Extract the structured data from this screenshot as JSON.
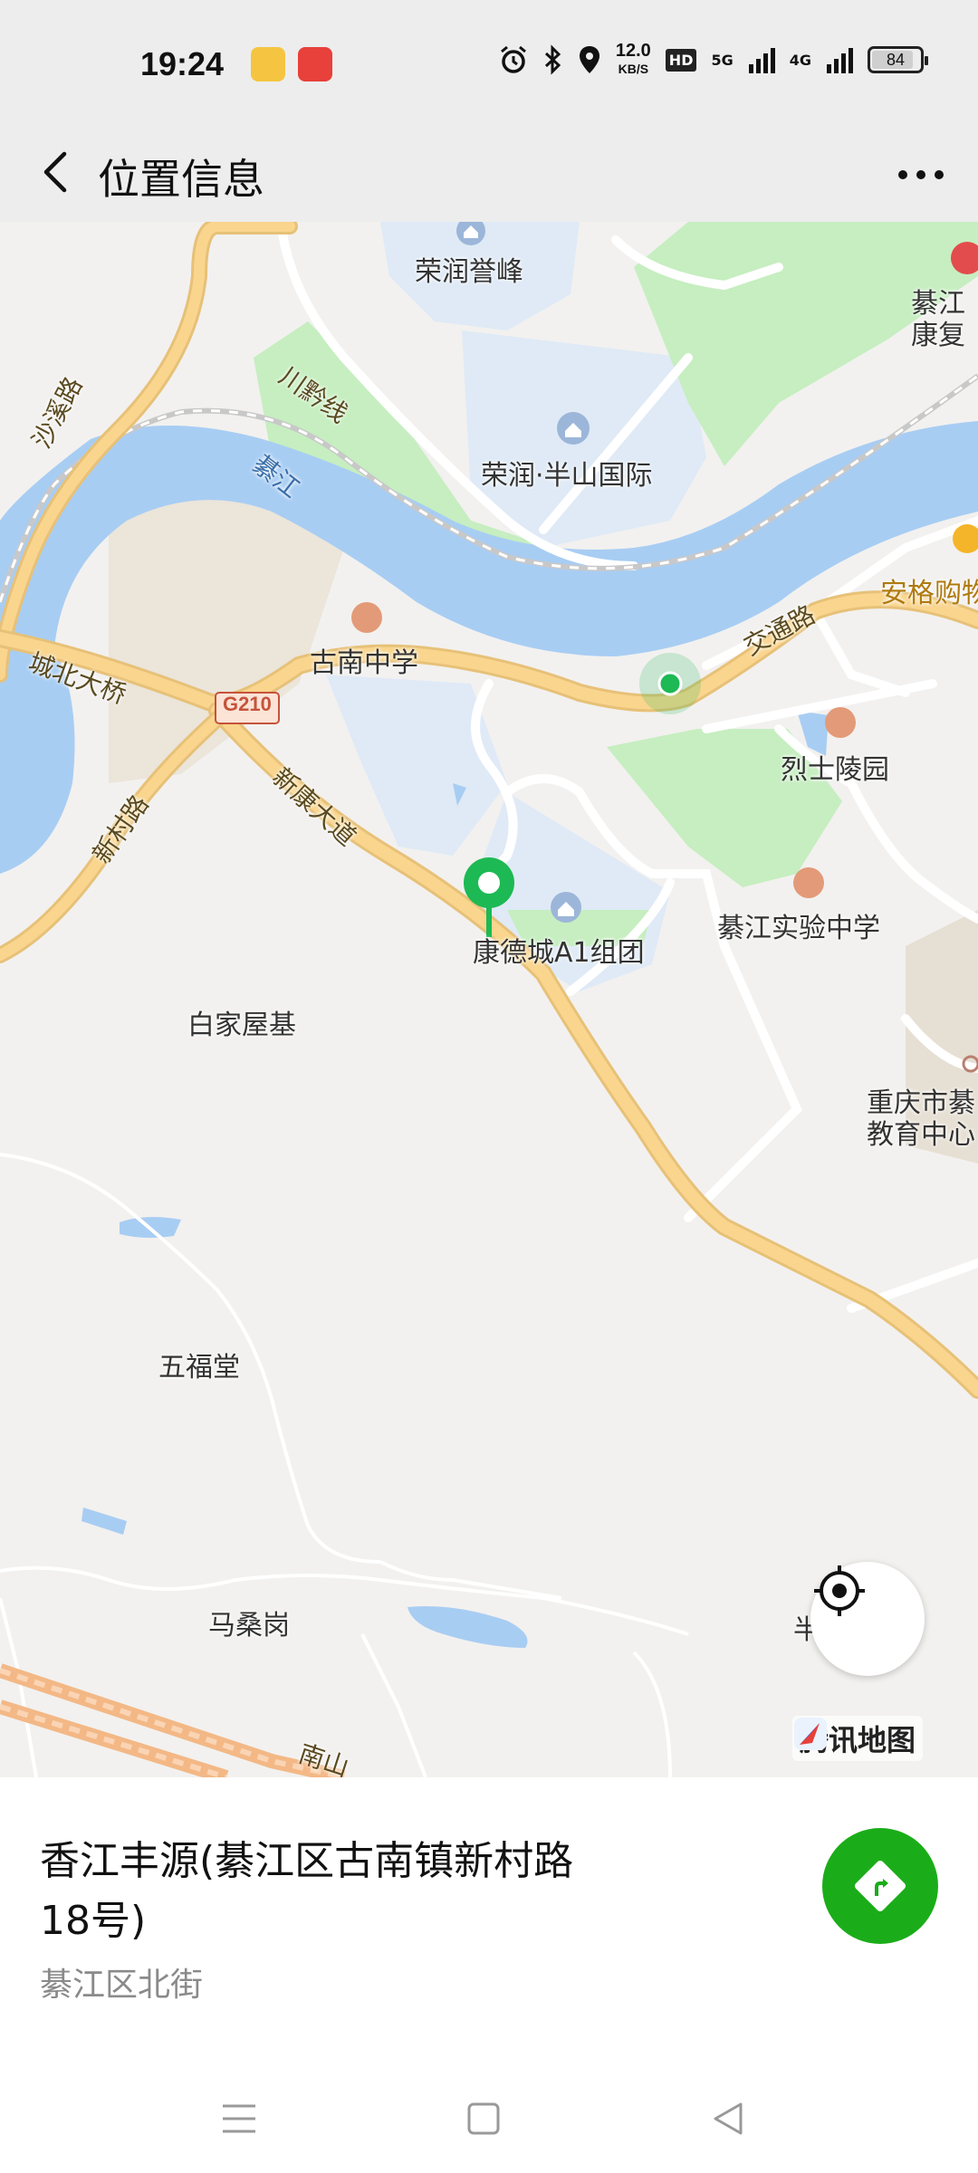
{
  "status_bar": {
    "time": "19:24",
    "net_speed_value": "12.0",
    "net_speed_unit": "KB/S",
    "hd_badge": "HD",
    "network_1": "5G",
    "network_2": "4G",
    "battery": "84",
    "icons": [
      "alarm-icon",
      "bluetooth-icon",
      "location-icon",
      "signal-icon"
    ]
  },
  "navbar": {
    "title": "位置信息"
  },
  "map": {
    "places": {
      "rongrun_yufeng": "荣润誉峰",
      "rongrun_banshan": "荣润·半山国际",
      "qijiang_kangfu": "綦江",
      "qijiang_kangfu_2": "康复",
      "anger_shopping": "安格购物",
      "gunan_school": "古南中学",
      "martyrs_park": "烈士陵园",
      "kangde_city": "康德城A1组团",
      "qijiang_experimental": "綦江实验中学",
      "baijia_wuji": "白家屋基",
      "chongqing_edu_1": "重庆市綦",
      "chongqing_edu_2": "教育中心",
      "wufu_tang": "五福堂",
      "masang_gang": "马桑岗",
      "partial_right": "半"
    },
    "roads": {
      "shaxi_road": "沙溪路",
      "chuanqian_line": "川黔线",
      "qijiang_river": "綦江",
      "chengbei_bridge": "城北大桥",
      "g210": "G210",
      "xinkang_avenue": "新康大道",
      "xincun_road": "新村路",
      "jiaotong_road": "交通路",
      "nanshan": "南山"
    },
    "logo": "腾讯地图",
    "colors": {
      "water": "#a8cdf3",
      "green": "#c6eec0",
      "road_main": "#f9d58e",
      "residential": "#dfeaf6",
      "marker": "#1db954"
    }
  },
  "info": {
    "place_name": "香江丰源(綦江区古南镇新村路18号)",
    "address": "綦江区北街"
  }
}
